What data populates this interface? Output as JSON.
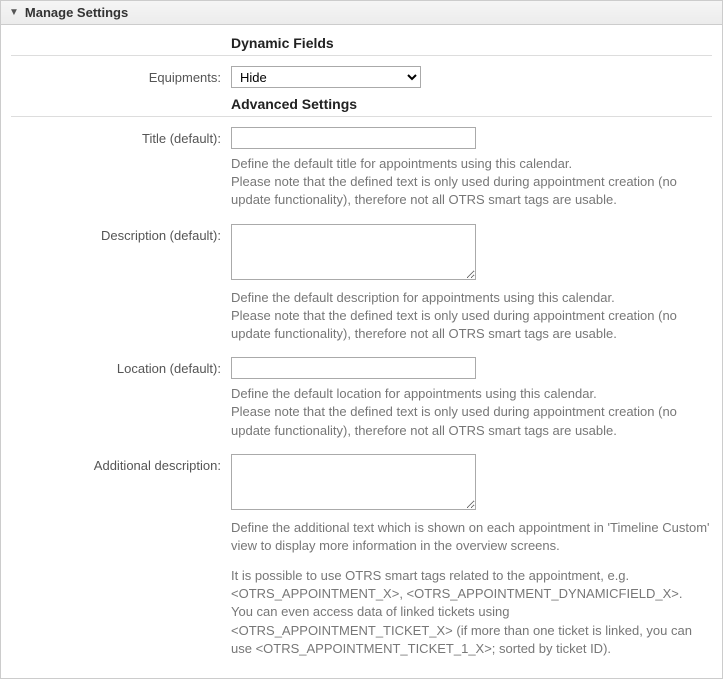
{
  "header": {
    "title": "Manage Settings"
  },
  "sections": {
    "dynamic_fields": {
      "heading": "Dynamic Fields"
    },
    "advanced": {
      "heading": "Advanced Settings"
    }
  },
  "fields": {
    "equipments": {
      "label": "Equipments:",
      "selected": "Hide"
    },
    "title_default": {
      "label": "Title (default):",
      "value": "",
      "desc1": "Define the default title for appointments using this calendar.",
      "desc2": "Please note that the defined text is only used during appointment creation (no update functionality), therefore not all OTRS smart tags are usable."
    },
    "description_default": {
      "label": "Description (default):",
      "value": "",
      "desc1": "Define the default description for appointments using this calendar.",
      "desc2": "Please note that the defined text is only used during appointment creation (no update functionality), therefore not all OTRS smart tags are usable."
    },
    "location_default": {
      "label": "Location (default):",
      "value": "",
      "desc1": "Define the default location for appointments using this calendar.",
      "desc2": "Please note that the defined text is only used during appointment creation (no update functionality), therefore not all OTRS smart tags are usable."
    },
    "additional_description": {
      "label": "Additional description:",
      "value": "",
      "desc1": "Define the additional text which is shown on each appointment in 'Timeline Custom' view to display more information in the overview screens.",
      "desc2": "It is possible to use OTRS smart tags related to the appointment, e.g. <OTRS_APPOINTMENT_X>, <OTRS_APPOINTMENT_DYNAMICFIELD_X>.",
      "desc3": "You can even access data of linked tickets using <OTRS_APPOINTMENT_TICKET_X> (if more than one ticket is linked, you can use <OTRS_APPOINTMENT_TICKET_1_X>; sorted by ticket ID)."
    }
  }
}
